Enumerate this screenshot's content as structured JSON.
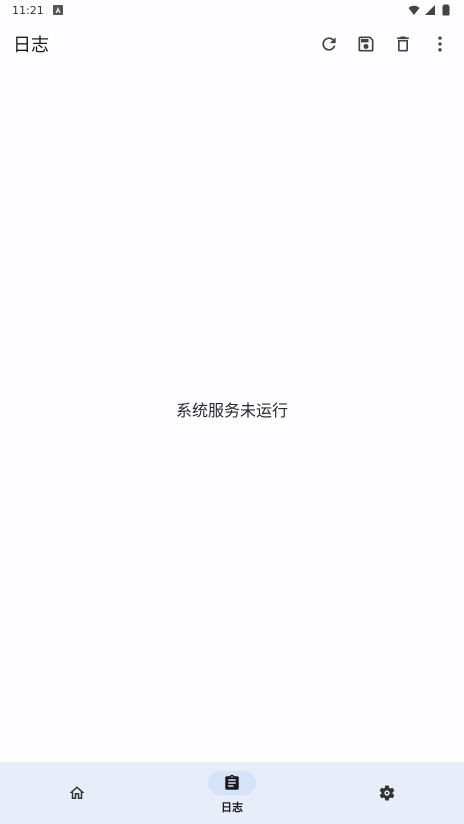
{
  "status_bar": {
    "time": "11:21"
  },
  "app_bar": {
    "title": "日志",
    "actions": [
      {
        "name": "refresh-icon"
      },
      {
        "name": "save-icon"
      },
      {
        "name": "delete-icon"
      },
      {
        "name": "more-vert-icon"
      }
    ]
  },
  "content": {
    "empty_message": "系统服务未运行"
  },
  "bottom_nav": {
    "items": [
      {
        "name": "home-icon",
        "label": ""
      },
      {
        "name": "clipboard-icon",
        "label": "日志",
        "active": true
      },
      {
        "name": "settings-icon",
        "label": ""
      }
    ]
  },
  "colors": {
    "background": "#fdfcff",
    "nav_background": "#e8eef9",
    "active_pill": "#d6e2f8"
  }
}
